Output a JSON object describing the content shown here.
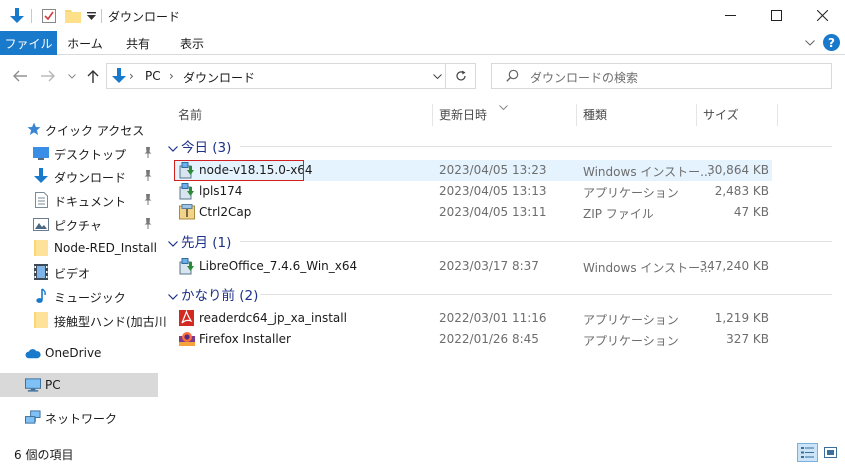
{
  "window": {
    "title": "ダウンロード",
    "minimize_glyph": "—",
    "maximize_glyph": "☐",
    "close_glyph": "✕"
  },
  "ribbon": {
    "tabs": [
      "ファイル",
      "ホーム",
      "共有",
      "表示"
    ],
    "expand_glyph": "⌄",
    "help_glyph": "?"
  },
  "address": {
    "back_glyph": "←",
    "forward_glyph": "→",
    "recent_glyph": "⌄",
    "up_glyph": "↑",
    "path": [
      "PC",
      "ダウンロード"
    ],
    "separator": "›",
    "dropdown_glyph": "⌄",
    "refresh_glyph": "↻"
  },
  "search": {
    "placeholder": "ダウンロードの検索",
    "icon": "search-icon"
  },
  "nav": {
    "quick_access": "クイック アクセス",
    "items": [
      {
        "label": "デスクトップ",
        "icon": "desktop-icon",
        "pinned": true
      },
      {
        "label": "ダウンロード",
        "icon": "download-icon",
        "pinned": true
      },
      {
        "label": "ドキュメント",
        "icon": "document-icon",
        "pinned": true
      },
      {
        "label": "ピクチャ",
        "icon": "picture-icon",
        "pinned": true
      },
      {
        "label": "Node-RED_Install",
        "icon": "folder-icon",
        "pinned": false
      },
      {
        "label": "ビデオ",
        "icon": "video-icon",
        "pinned": false
      },
      {
        "label": "ミュージック",
        "icon": "music-icon",
        "pinned": false
      },
      {
        "label": "接触型ハンド(加古川",
        "icon": "folder-icon",
        "pinned": false
      }
    ],
    "onedrive": "OneDrive",
    "pc": "PC",
    "network": "ネットワーク",
    "pin_glyph": "📌"
  },
  "columns": {
    "name": "名前",
    "modified": "更新日時",
    "type": "種類",
    "size": "サイズ",
    "sort_glyph": "⌄"
  },
  "groups": [
    {
      "title": "今日 (3)",
      "files": [
        {
          "name": "node-v18.15.0-x64",
          "date": "2023/04/05 13:23",
          "type": "Windows インストー...",
          "size": "30,864 KB",
          "icon": "installer-icon"
        },
        {
          "name": "lpls174",
          "date": "2023/04/05 13:13",
          "type": "アプリケーション",
          "size": "2,483 KB",
          "icon": "installer-icon"
        },
        {
          "name": "Ctrl2Cap",
          "date": "2023/04/05 13:11",
          "type": "ZIP ファイル",
          "size": "47 KB",
          "icon": "zip-icon"
        }
      ]
    },
    {
      "title": "先月 (1)",
      "files": [
        {
          "name": "LibreOffice_7.4.6_Win_x64",
          "date": "2023/03/17 8:37",
          "type": "Windows インストー...",
          "size": "347,240 KB",
          "icon": "installer-icon"
        }
      ]
    },
    {
      "title": "かなり前 (2)",
      "files": [
        {
          "name": "readerdc64_jp_xa_install",
          "date": "2022/03/01 11:16",
          "type": "アプリケーション",
          "size": "1,219 KB",
          "icon": "acrobat-icon"
        },
        {
          "name": "Firefox Installer",
          "date": "2022/01/26 8:45",
          "type": "アプリケーション",
          "size": "327 KB",
          "icon": "firefox-icon"
        }
      ]
    }
  ],
  "status": {
    "item_count": "6 個の項目"
  },
  "colors": {
    "accent": "#1979ca",
    "group_title": "#1e3287",
    "hover_row": "#e5f3ff",
    "selected_nav": "#d9d9d9",
    "focus_border": "#d21f1f"
  }
}
